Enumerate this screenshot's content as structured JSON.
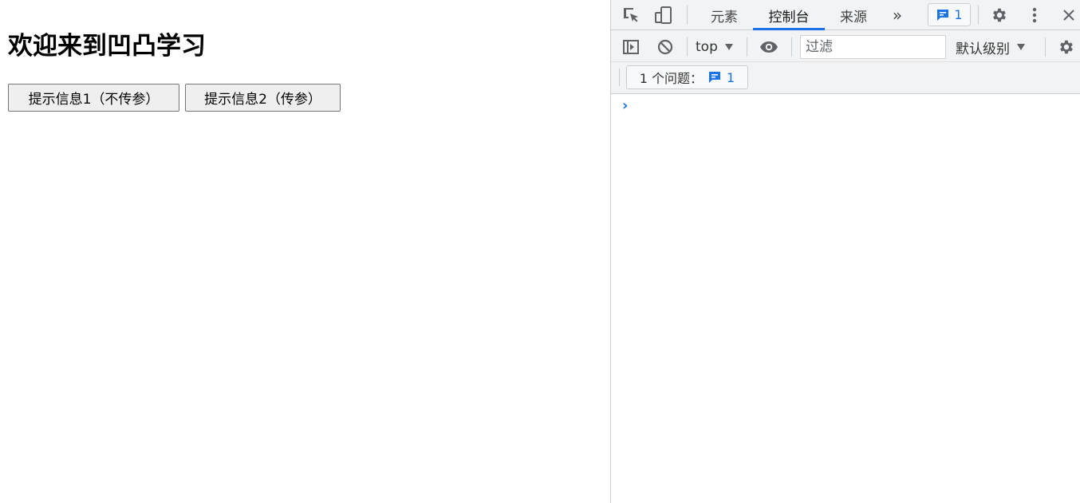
{
  "page": {
    "title": "欢迎来到凹凸学习",
    "buttons": [
      {
        "label": "提示信息1（不传参）"
      },
      {
        "label": "提示信息2（传参）"
      }
    ]
  },
  "devtools": {
    "tabs": [
      {
        "label": "元素",
        "active": false
      },
      {
        "label": "控制台",
        "active": true
      },
      {
        "label": "来源",
        "active": false
      }
    ],
    "more_tabs_glyph": "»",
    "message_count": "1",
    "toolbar": {
      "context": "top",
      "filter_placeholder": "过滤",
      "filter_value": "",
      "log_level": "默认级别"
    },
    "issues": {
      "label": "1 个问题：",
      "count": "1"
    },
    "console_prompt": "›"
  },
  "colors": {
    "accent": "#1a73e8",
    "toolbar_bg": "#f1f3f4",
    "border": "#cbcdd1",
    "icon": "#5f6368"
  },
  "icons": [
    "inspect-element-icon",
    "device-toggle-icon",
    "messages-icon",
    "settings-icon",
    "kebab-menu-icon",
    "close-icon",
    "sidebar-toggle-icon",
    "clear-console-icon",
    "live-expression-eye-icon",
    "dropdown-caret-icon",
    "console-settings-icon",
    "prompt-chevron-icon"
  ]
}
